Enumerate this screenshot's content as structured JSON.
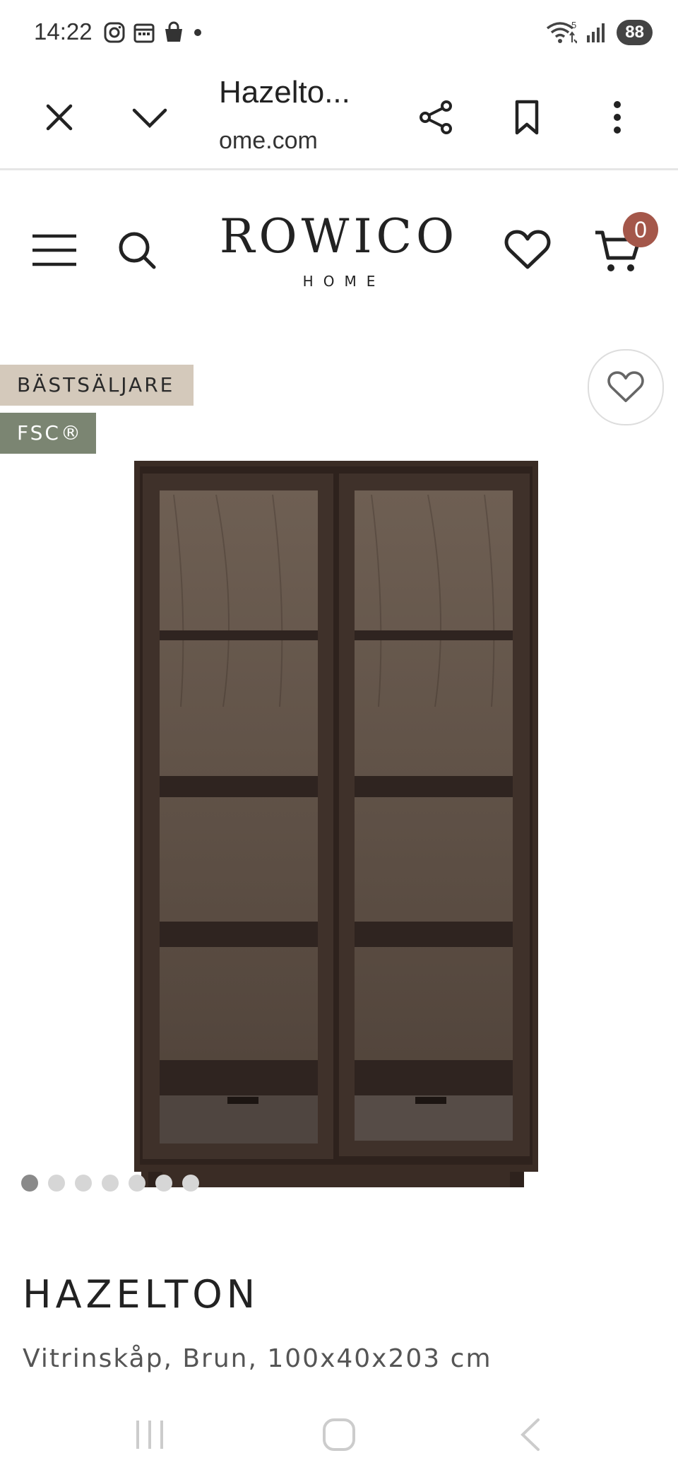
{
  "status_bar": {
    "time": "14:22",
    "battery": "88",
    "wifi_badge": "5"
  },
  "browser": {
    "title": "Hazelto...",
    "url": "ome.com"
  },
  "site": {
    "logo": "ROWICO",
    "logo_sub": "HOME",
    "cart_count": "0"
  },
  "gallery": {
    "badges": [
      "BÄSTSÄLJARE",
      "FSC®"
    ],
    "dot_count": 7,
    "active_dot": 0
  },
  "product": {
    "name": "HAZELTON",
    "description": "Vitrinskåp, Brun, 100x40x203 cm"
  },
  "colors": {
    "accent": "#a4574a",
    "badge_best": "#d4c9bb",
    "badge_fsc": "#7b8572",
    "wood_dark": "#3a2c25"
  }
}
